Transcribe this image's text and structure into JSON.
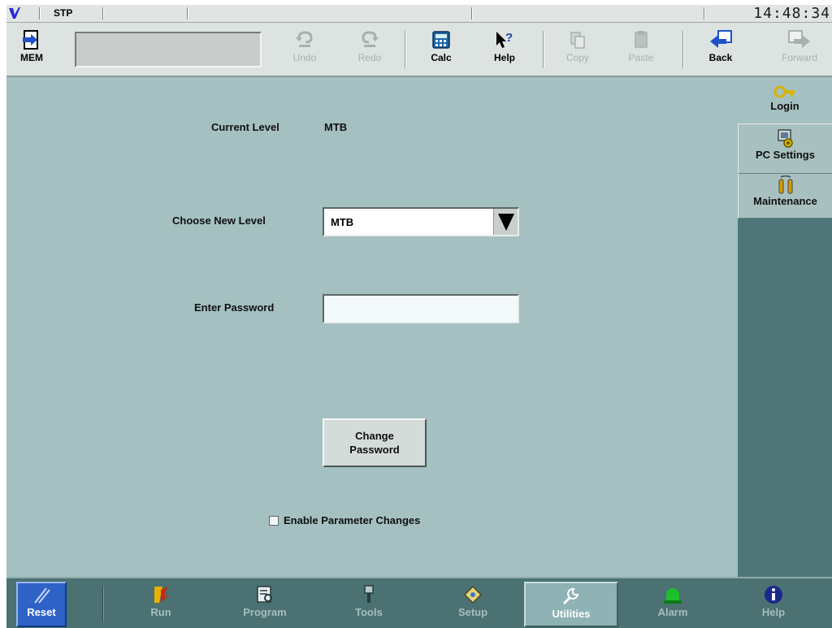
{
  "status": {
    "mode": "STP",
    "clock": "14:48:34"
  },
  "toolbar": {
    "mem": "MEM",
    "undo": "Undo",
    "redo": "Redo",
    "calc": "Calc",
    "help": "Help",
    "copy": "Copy",
    "paste": "Paste",
    "back": "Back",
    "forward": "Forward"
  },
  "form": {
    "current_level_label": "Current Level",
    "current_level_value": "MTB",
    "choose_level_label": "Choose New Level",
    "choose_level_value": "MTB",
    "password_label": "Enter Password",
    "password_value": "",
    "change_password_line1": "Change",
    "change_password_line2": "Password",
    "enable_param_label": "Enable Parameter Changes"
  },
  "side_tabs": {
    "login": "Login",
    "pc_settings": "PC Settings",
    "maintenance": "Maintenance"
  },
  "bottom": {
    "reset": "Reset",
    "run": "Run",
    "program": "Program",
    "tools": "Tools",
    "setup": "Setup",
    "utilities": "Utilities",
    "alarm": "Alarm",
    "help": "Help"
  },
  "colors": {
    "background": "#a4c0c0",
    "side_panel": "#4e7678",
    "reset_blue": "#2f62c6",
    "alarm_green": "#1cc02c"
  }
}
